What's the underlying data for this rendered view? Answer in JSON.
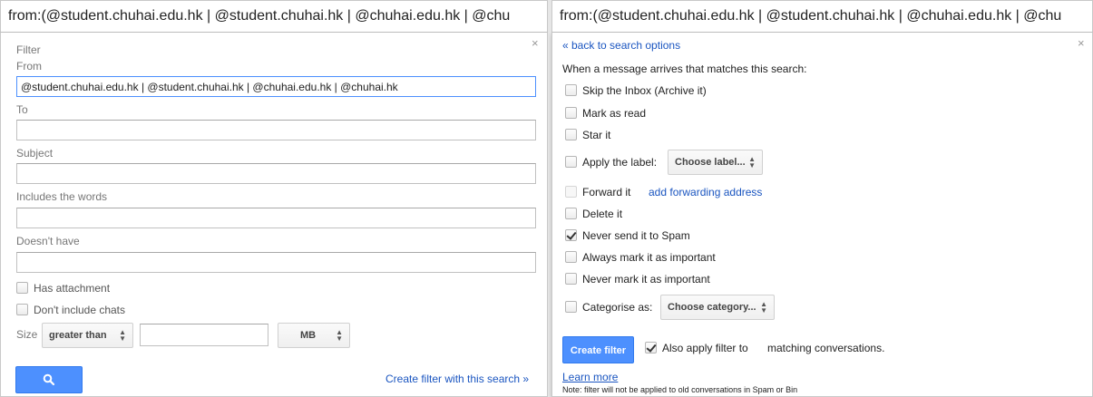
{
  "left": {
    "search_text": "from:(@student.chuhai.edu.hk | @student.chuhai.hk | @chuhai.edu.hk | @chu",
    "close_label": "×",
    "filter_heading": "Filter",
    "from_label": "From",
    "from_value": "@student.chuhai.edu.hk | @student.chuhai.hk | @chuhai.edu.hk | @chuhai.hk",
    "to_label": "To",
    "to_value": "",
    "subject_label": "Subject",
    "subject_value": "",
    "includes_label": "Includes the words",
    "includes_value": "",
    "doesnt_have_label": "Doesn't have",
    "doesnt_have_value": "",
    "has_attachment_label": "Has attachment",
    "has_attachment_checked": false,
    "no_chats_label": "Don't include chats",
    "no_chats_checked": false,
    "size_label": "Size",
    "size_operator": "greater than",
    "size_value": "",
    "size_unit": "MB",
    "create_filter_link": "Create filter with this search »",
    "search_button_icon": "search-icon"
  },
  "right": {
    "search_text": "from:(@student.chuhai.edu.hk | @student.chuhai.hk | @chuhai.edu.hk | @chu",
    "close_label": "×",
    "back_link": "« back to search options",
    "intro": "When a message arrives that matches this search:",
    "options": {
      "skip_inbox": "Skip the Inbox (Archive it)",
      "mark_read": "Mark as read",
      "star_it": "Star it",
      "apply_label": "Apply the label:",
      "choose_label": "Choose label...",
      "forward_it": "Forward it",
      "add_forwarding": "add forwarding address",
      "delete_it": "Delete it",
      "never_spam": "Never send it to Spam",
      "always_important": "Always mark it as important",
      "never_important": "Never mark it as important",
      "categorise": "Categorise as:",
      "choose_category": "Choose category..."
    },
    "never_spam_checked": true,
    "create_filter_button": "Create filter",
    "also_apply_label": "Also apply filter to",
    "matching_label": "matching conversations.",
    "also_apply_checked": true,
    "learn_more": "Learn more",
    "note": "Note: filter will not be applied to old conversations in Spam or Bin"
  }
}
